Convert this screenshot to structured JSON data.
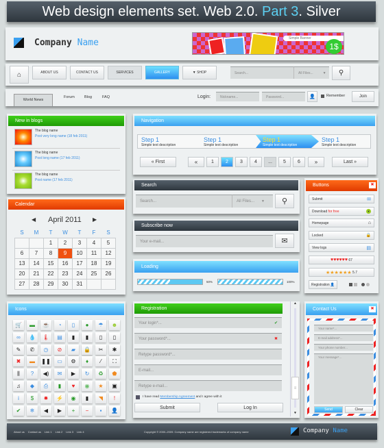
{
  "title": {
    "part1": "Web design elements set. Web 2.0. ",
    "part2": "Part 3",
    "part3": ". Silver"
  },
  "header": {
    "company_a": "Company",
    "company_b": "Name",
    "banner": "Simple Banner",
    "banner_price": "1$"
  },
  "nav": {
    "items": [
      "ABOUT US",
      "CONTACT US",
      "SERVICES",
      "GALLERY",
      "▼ SHOP"
    ],
    "search_placeholder": "Search...",
    "search_scope": "All Files..."
  },
  "tabs": {
    "items": [
      "World News",
      "Forum",
      "Blog",
      "FAQ"
    ],
    "login_label": "Login:",
    "nickname": "Nickname...",
    "password": "Password...",
    "remember": "Remember",
    "join": "Join"
  },
  "blogs": {
    "title": "New in blogs",
    "items": [
      {
        "name": "The blog name",
        "post": "Post very long name (18 feb 2011)"
      },
      {
        "name": "The blog name",
        "post": "Post long name (17 feb 2011)"
      },
      {
        "name": "The blog name",
        "post": "Post name (17 feb 2011)"
      }
    ]
  },
  "calendar": {
    "title": "Calendar",
    "month": "April 2011",
    "weekdays": [
      "S",
      "M",
      "T",
      "W",
      "T",
      "F",
      "S"
    ],
    "weeks": [
      [
        "",
        "",
        "1",
        "2",
        "3",
        "4",
        "5"
      ],
      [
        "6",
        "7",
        "8",
        "9",
        "10",
        "11",
        "12"
      ],
      [
        "13",
        "14",
        "15",
        "16",
        "17",
        "18",
        "19"
      ],
      [
        "20",
        "21",
        "22",
        "23",
        "24",
        "25",
        "26"
      ],
      [
        "27",
        "28",
        "29",
        "30",
        "31",
        "",
        ""
      ]
    ],
    "selected": "9"
  },
  "icons": {
    "title": "Icons",
    "items": [
      [
        "cart",
        "🛒",
        "#3b8de0"
      ],
      [
        "money",
        "▬",
        "#2a9a2a"
      ],
      [
        "coffee",
        "☕",
        "#222"
      ],
      [
        "pie-chart",
        "◔",
        "#3b8de0"
      ],
      [
        "phone-device",
        "▯",
        "#3b8de0"
      ],
      [
        "android",
        "●",
        "#2a9a2a"
      ],
      [
        "umbrella",
        "☂",
        "#3b8de0"
      ],
      [
        "smiley",
        "☻",
        "#9c3"
      ],
      [
        "glasses",
        "∞",
        "#3b8de0"
      ],
      [
        "drop",
        "💧",
        "#3b8de0"
      ],
      [
        "thermometer",
        "🌡",
        "#e22"
      ],
      [
        "document",
        "▤",
        "#3b8de0"
      ],
      [
        "battery-1",
        "▮",
        "#222"
      ],
      [
        "battery-2",
        "▮",
        "#222"
      ],
      [
        "battery-3",
        "▯",
        "#222"
      ],
      [
        "battery-4",
        "▯",
        "#222"
      ],
      [
        "pen",
        "✎",
        "#222"
      ],
      [
        "phone",
        "✆",
        "#222"
      ],
      [
        "clock",
        "◷",
        "#3b8de0"
      ],
      [
        "forbidden",
        "⊘",
        "#e22"
      ],
      [
        "briefcase",
        "▰",
        "#3b8de0"
      ],
      [
        "lock",
        "🔒",
        "#3b8de0"
      ],
      [
        "scissors",
        "✂",
        "#222"
      ],
      [
        "settings",
        "✱",
        "#222"
      ],
      [
        "close",
        "✖",
        "#e22"
      ],
      [
        "folder",
        "▬",
        "#f08a20"
      ],
      [
        "pause",
        "❚❚",
        "#222"
      ],
      [
        "chat",
        "▭",
        "#3b8de0"
      ],
      [
        "gear",
        "⚙",
        "#222"
      ],
      [
        "pin",
        "♦",
        "#2a9a2a"
      ],
      [
        "brush",
        "⁄",
        "#222"
      ],
      [
        "fullscreen",
        "⛶",
        "#222"
      ],
      [
        "sliders",
        "⫼",
        "#222"
      ],
      [
        "question",
        "?",
        "#3b8de0"
      ],
      [
        "volume",
        "◀)",
        "#222"
      ],
      [
        "mail",
        "✉",
        "#3b8de0"
      ],
      [
        "play",
        "▶",
        "#222"
      ],
      [
        "refresh",
        "↻",
        "#3b8de0"
      ],
      [
        "recycle",
        "♻",
        "#2a9a2a"
      ],
      [
        "badge",
        "⬟",
        "#f08a20"
      ],
      [
        "music",
        "♫",
        "#222"
      ],
      [
        "tag",
        "◆",
        "#3b8de0"
      ],
      [
        "printer",
        "⎙",
        "#3b8de0"
      ],
      [
        "bar-chart",
        "▮",
        "#2a9a2a"
      ],
      [
        "heart",
        "♥",
        "#e22"
      ],
      [
        "globe",
        "◉",
        "#6b6"
      ],
      [
        "star",
        "★",
        "#f08a20"
      ],
      [
        "camera",
        "▣",
        "#222"
      ],
      [
        "info",
        "i",
        "#3b8de0"
      ],
      [
        "dollar",
        "$",
        "#2a9a2a"
      ],
      [
        "sun",
        "✹",
        "#e22"
      ],
      [
        "lightning",
        "⚡",
        "#222"
      ],
      [
        "eye",
        "◉",
        "#2a9a2a"
      ],
      [
        "clipboard",
        "▮",
        "#222"
      ],
      [
        "rss",
        "◥",
        "#f08a20"
      ],
      [
        "exclamation",
        "!",
        "#e22"
      ],
      [
        "check",
        "✔",
        "#2a9a2a"
      ],
      [
        "snowflake",
        "❄",
        "#3b8de0"
      ],
      [
        "arrow-left",
        "◀",
        "#222"
      ],
      [
        "arrow-right",
        "▶",
        "#222"
      ],
      [
        "plus",
        "+",
        "#2a9a2a"
      ],
      [
        "minus",
        "−",
        "#e22"
      ],
      [
        "save",
        "▪",
        "#3b8de0"
      ],
      [
        "user",
        "👤",
        "#2a9a2a"
      ]
    ]
  },
  "navigation": {
    "title": "Navigation",
    "steps": [
      {
        "t": "Step 1",
        "d": "Simple text description"
      },
      {
        "t": "Step 1",
        "d": "Simple text description"
      },
      {
        "t": "Step 1",
        "d": "Simple text description"
      },
      {
        "t": "Step 1",
        "d": "Simple text description"
      }
    ],
    "first": "« First",
    "last": "Last »",
    "prev": "«",
    "next": "»",
    "pages": [
      "1",
      "2",
      "3",
      "4",
      "...",
      "5",
      "6"
    ],
    "current": "2"
  },
  "search": {
    "title": "Search",
    "placeholder": "Search...",
    "scope": "All Files..."
  },
  "subscribe": {
    "title": "Subscribe now",
    "placeholder": "Your e-mail..."
  },
  "loading": {
    "title": "Loading",
    "bars": [
      {
        "value": 50,
        "label": "50%"
      },
      {
        "value": 100,
        "label": "100%"
      }
    ]
  },
  "registration": {
    "title": "Registration",
    "fields": [
      "Your login*...",
      "Your password*...",
      "Retype password*...",
      "E-mail...",
      "Retype e-mail..."
    ],
    "agree_pre": "I have read ",
    "agree_link": "Membership Agreement",
    "agree_post": " and I agree with it",
    "submit": "Submit",
    "login": "Log In"
  },
  "buttons": {
    "title": "Buttons",
    "submit": "Submit",
    "download": "Download ",
    "download_hl": "for free",
    "homepage": "Homepage",
    "locked": "Locked",
    "view_logs": "View logs",
    "hearts_count": "67",
    "stars_count": "5.7",
    "registration": "Registration",
    "hearts_value": 5.5,
    "stars_value": 5.7
  },
  "contact": {
    "title": "Contact Us",
    "name": "Your name*...",
    "email": "E-mail address*...",
    "phone": "Your phone number...",
    "message": "Your message*...",
    "send": "Send",
    "clear": "Clear"
  },
  "footer": {
    "links": [
      "About us",
      "Contact us",
      "Link 1",
      "Link 2",
      "Link 3",
      "Link 4"
    ],
    "copyright": "Copyright © 2000–2009. Company name are registered trademarks of company name",
    "company_a": "Company",
    "company_b": "Name"
  }
}
